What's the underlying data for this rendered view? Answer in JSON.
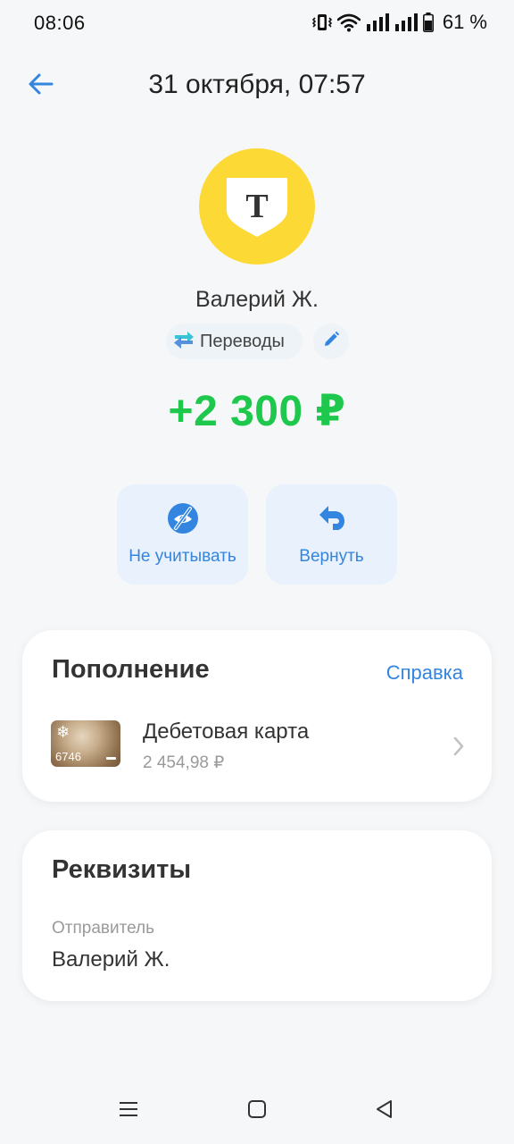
{
  "status_bar": {
    "time": "08:06",
    "battery": "61 %",
    "icons": [
      "vibrate-icon",
      "wifi-icon",
      "signal-icon",
      "signal-icon",
      "battery-icon"
    ]
  },
  "header": {
    "title": "31 октября, 07:57",
    "back_icon": "arrow-left-icon"
  },
  "transaction": {
    "bank_logo_letter": "T",
    "sender_name": "Валерий Ж.",
    "category": "Переводы",
    "amount": "+2 300 ₽",
    "amount_color": "#1ec84c"
  },
  "actions": {
    "exclude_label": "Не учитывать",
    "return_label": "Вернуть"
  },
  "topup": {
    "title": "Пополнение",
    "help_link": "Справка",
    "account": {
      "name": "Дебетовая карта",
      "balance": "2 454,98 ₽",
      "card_last4": "6746"
    }
  },
  "details": {
    "title": "Реквизиты",
    "sender_label": "Отправитель",
    "sender_value": "Валерий Ж."
  },
  "colors": {
    "accent": "#3385e0",
    "logo_yellow": "#fcd935",
    "positive": "#1ec84c"
  }
}
